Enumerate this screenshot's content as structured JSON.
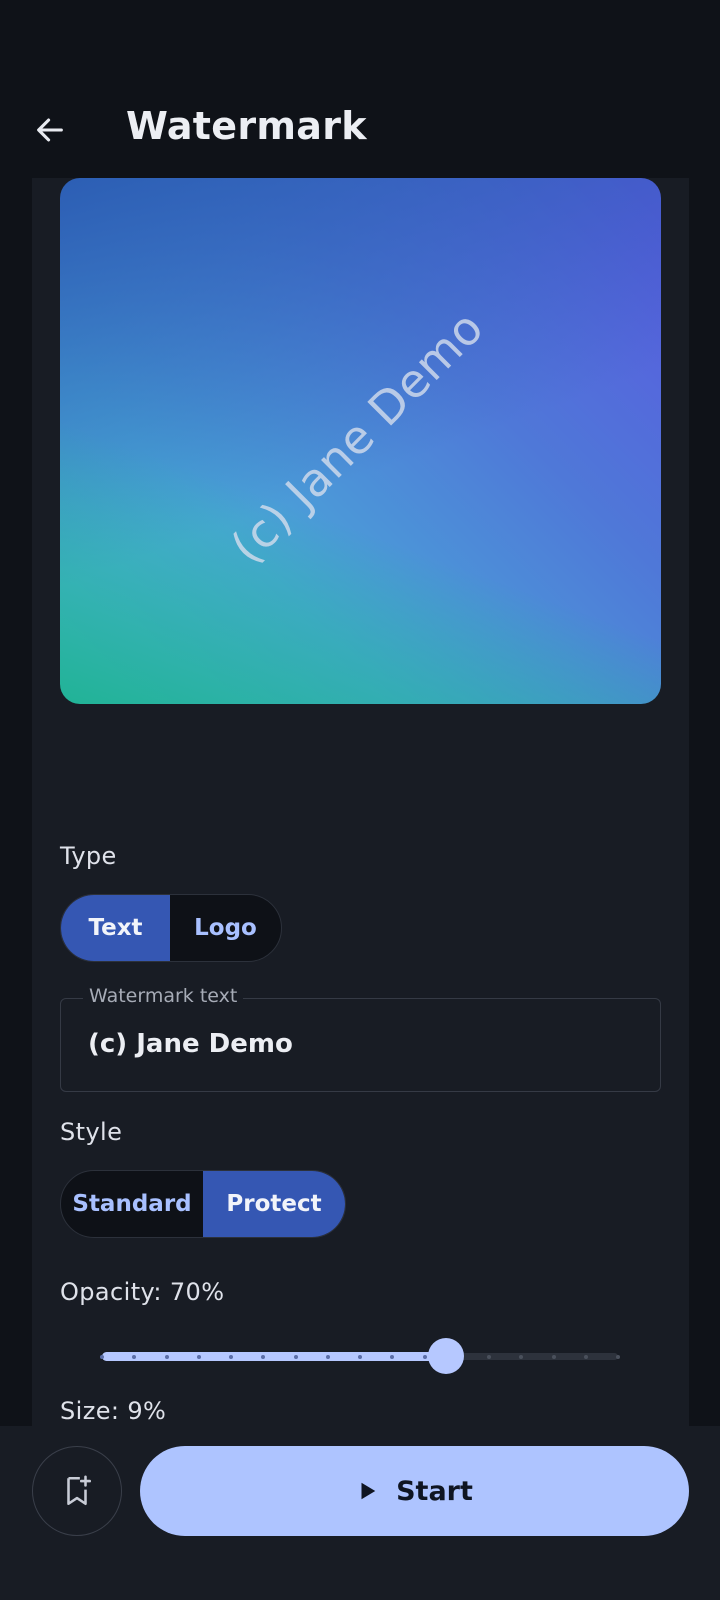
{
  "header": {
    "title": "Watermark",
    "back_icon": "arrow-left-icon"
  },
  "preview": {
    "watermark_text": "(c) Jane Demo"
  },
  "type_section": {
    "label": "Type",
    "options": [
      "Text",
      "Logo"
    ],
    "selected": "Text"
  },
  "watermark_field": {
    "label": "Watermark text",
    "value": "(c) Jane Demo"
  },
  "style_section": {
    "label": "Style",
    "options": [
      "Standard",
      "Protect"
    ],
    "selected": "Protect"
  },
  "opacity": {
    "label": "Opacity: 70%",
    "value_percent": 70
  },
  "size": {
    "label": "Size: 9%",
    "value_percent": 9
  },
  "bottom": {
    "bookmark_icon": "bookmark-add-icon",
    "start_label": "Start",
    "start_icon": "play-icon"
  },
  "colors": {
    "accent": "#aec4ff",
    "segment_active": "#3557b3",
    "background": "#0f1218",
    "panel": "#181c24"
  }
}
